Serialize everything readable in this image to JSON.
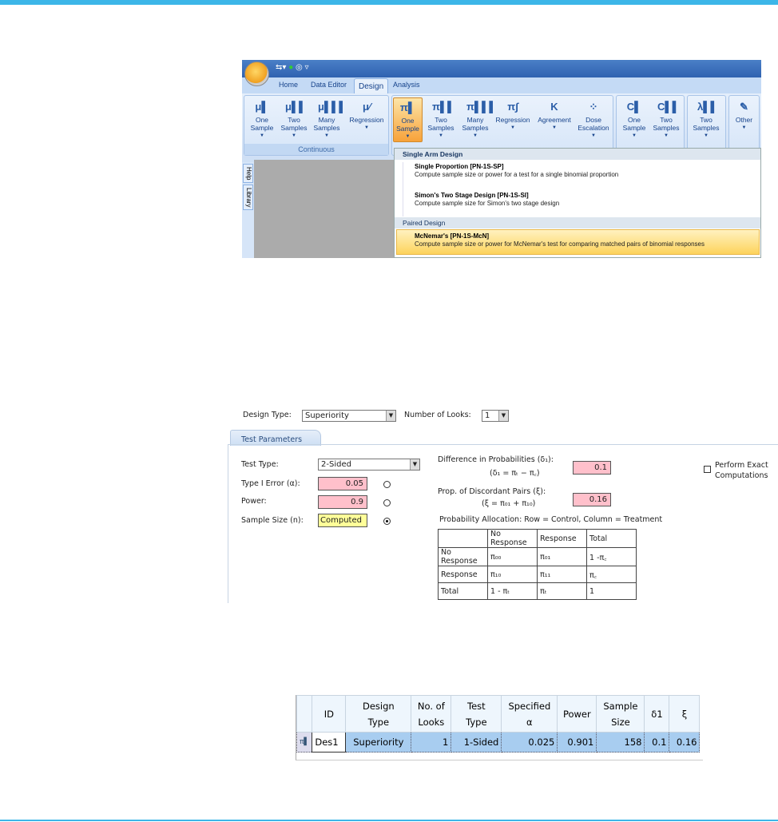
{
  "app_ribbon": {
    "tabs": [
      "Home",
      "Data Editor",
      "Design",
      "Analysis"
    ],
    "selected_tab": "Design",
    "groups": [
      {
        "label": "Continuous",
        "buttons": [
          {
            "icon": "mu-one-icon",
            "label": "One Sample"
          },
          {
            "icon": "mu-two-icon",
            "label": "Two Samples"
          },
          {
            "icon": "mu-many-icon",
            "label": "Many Samples"
          },
          {
            "icon": "mu-regression-icon",
            "label": "Regression"
          }
        ]
      },
      {
        "label": "",
        "buttons": [
          {
            "icon": "pi-one-icon",
            "label": "One Sample",
            "active": true
          },
          {
            "icon": "pi-two-icon",
            "label": "Two Samples"
          },
          {
            "icon": "pi-many-icon",
            "label": "Many Samples"
          },
          {
            "icon": "pi-regression-icon",
            "label": "Regression"
          },
          {
            "icon": "kappa-icon",
            "label": "Agreement"
          },
          {
            "icon": "dose-escalation-icon",
            "label": "Dose Escalation"
          }
        ]
      },
      {
        "label": "",
        "buttons": [
          {
            "icon": "c-one-icon",
            "label": "One Sample"
          },
          {
            "icon": "c-two-icon",
            "label": "Two Samples"
          }
        ]
      },
      {
        "label": "",
        "buttons": [
          {
            "icon": "lambda-two-icon",
            "label": "Two Samples"
          }
        ]
      },
      {
        "label": "",
        "buttons": [
          {
            "icon": "pencil-icon",
            "label": "Other"
          }
        ]
      }
    ],
    "side_tabs": [
      "Help",
      "Library"
    ],
    "menu": {
      "sections": [
        {
          "header": "Single Arm Design",
          "items": [
            {
              "title": "Single Proportion [PN-1S-SP]",
              "desc": "Compute sample size or power for a test for a single binomial proportion"
            },
            {
              "title": "Simon's Two Stage Design [PN-1S-SI]",
              "desc": "Compute sample size for Simon's two stage design"
            }
          ]
        },
        {
          "header": "Paired Design",
          "items": [
            {
              "title": "McNemar's [PN-1S-McN]",
              "desc": "Compute sample size or power for McNemar's test for comparing matched pairs of binomial responses",
              "highlighted": true
            }
          ]
        }
      ]
    }
  },
  "input_form": {
    "design_type_label": "Design Type:",
    "design_type": "Superiority",
    "looks_label": "Number of Looks:",
    "looks": "1",
    "tab": "Test Parameters",
    "test_type_label": "Test Type:",
    "test_type": "2-Sided",
    "alpha_label": "Type I Error (α):",
    "alpha": "0.05",
    "power_label": "Power:",
    "power": "0.9",
    "n_label": "Sample Size (n):",
    "n": "Computed",
    "computed_selected": "Sample Size",
    "diff_label": "Difference in Probabilities (δ₁):",
    "diff_formula": "(δ₁ = πₜ − π꜀)",
    "diff": "0.1",
    "disc_label": "Prop. of Discordant Pairs (ξ):",
    "disc_formula": "(ξ = π₀₁ + π₁₀)",
    "disc": "0.16",
    "exact_label": "Perform Exact Computations",
    "exact_checked": false,
    "alloc_title": "Probability Allocation: Row = Control, Column = Treatment",
    "alloc_table": [
      [
        "",
        "No Response",
        "Response",
        "Total"
      ],
      [
        "No Response",
        "π₀₀",
        "π₀₁",
        "1 -π꜀"
      ],
      [
        "Response",
        "π₁₀",
        "π₁₁",
        "π꜀"
      ],
      [
        "Total",
        "1 - πₜ",
        "πₜ",
        "1"
      ]
    ]
  },
  "results": {
    "headers": [
      "ID",
      "Design Type",
      "No. of Looks",
      "Test Type",
      "Specified α",
      "Power",
      "Sample Size",
      "δ1",
      "ξ"
    ],
    "rows": [
      [
        "Des1",
        "Superiority",
        "1",
        "1-Sided",
        "0.025",
        "0.901",
        "158",
        "0.1",
        "0.16"
      ]
    ]
  },
  "colors": {
    "accent": "#3cb6e8",
    "required_field": "#ffc0cb",
    "computed_field": "#ffff99",
    "menu_highlight": "#fdd35c",
    "result_row": "#a8cdf0"
  }
}
